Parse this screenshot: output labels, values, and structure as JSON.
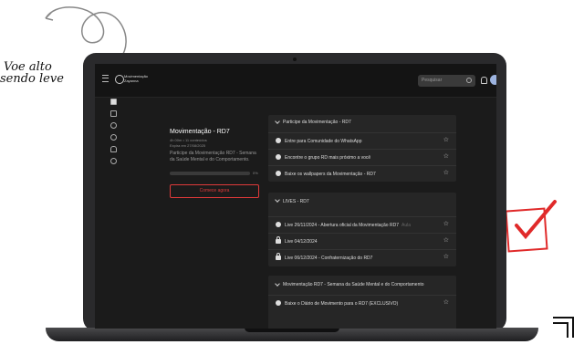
{
  "handwriting": {
    "line1": "Voe alto",
    "line2": "sendo leve"
  },
  "app": {
    "logo_text": "Movimentação Zayanna",
    "search_placeholder": "Pesquisar",
    "icons": {
      "menu": "hamburger-icon",
      "search": "search-icon",
      "bell": "bell-icon",
      "avatar": "avatar"
    }
  },
  "course": {
    "title": "Movimentação - RD7",
    "meta_line1": "4h 00m • 11 conteúdos",
    "meta_line2": "Expira em 27/08/2025",
    "description": "Participe da Movimentação RD7 - Semana da Saúde Mental e do Comportamento.",
    "progress_label": "0%",
    "progress": 0,
    "cta": "Comece agora"
  },
  "modules": [
    {
      "title": "Participe da Movimentação - RD7",
      "items": [
        {
          "label": "Entre para Comunidade do WhatsApp",
          "icon": "globe-icon",
          "tag": ""
        },
        {
          "label": "Encontre o grupo RD mais próximo a você",
          "icon": "globe-icon",
          "tag": ""
        },
        {
          "label": "Baixe os wallpapers da Movimentação - RD7",
          "icon": "globe-icon",
          "tag": ""
        }
      ]
    },
    {
      "title": "LIVES - RD7",
      "items": [
        {
          "label": "Live 26/11/2024 - Abertura oficial da Movimentação RD7",
          "icon": "play-icon",
          "tag": "Aula"
        },
        {
          "label": "Live 04/12/2024",
          "icon": "lock-icon",
          "tag": ""
        },
        {
          "label": "Live 06/12/2024 - Confraternização do RD7",
          "icon": "lock-icon",
          "tag": ""
        }
      ]
    },
    {
      "title": "Movimentação RD7 - Semana da Saúde Mental e do Comportamento",
      "items": [
        {
          "label": "Baixe o Diário de Movimento para o RD7 (EXCLUSIVO)",
          "icon": "globe-icon",
          "tag": ""
        }
      ]
    }
  ],
  "colors": {
    "accent": "#e03a3a",
    "background": "#1b1b1b",
    "panel": "#262626"
  }
}
